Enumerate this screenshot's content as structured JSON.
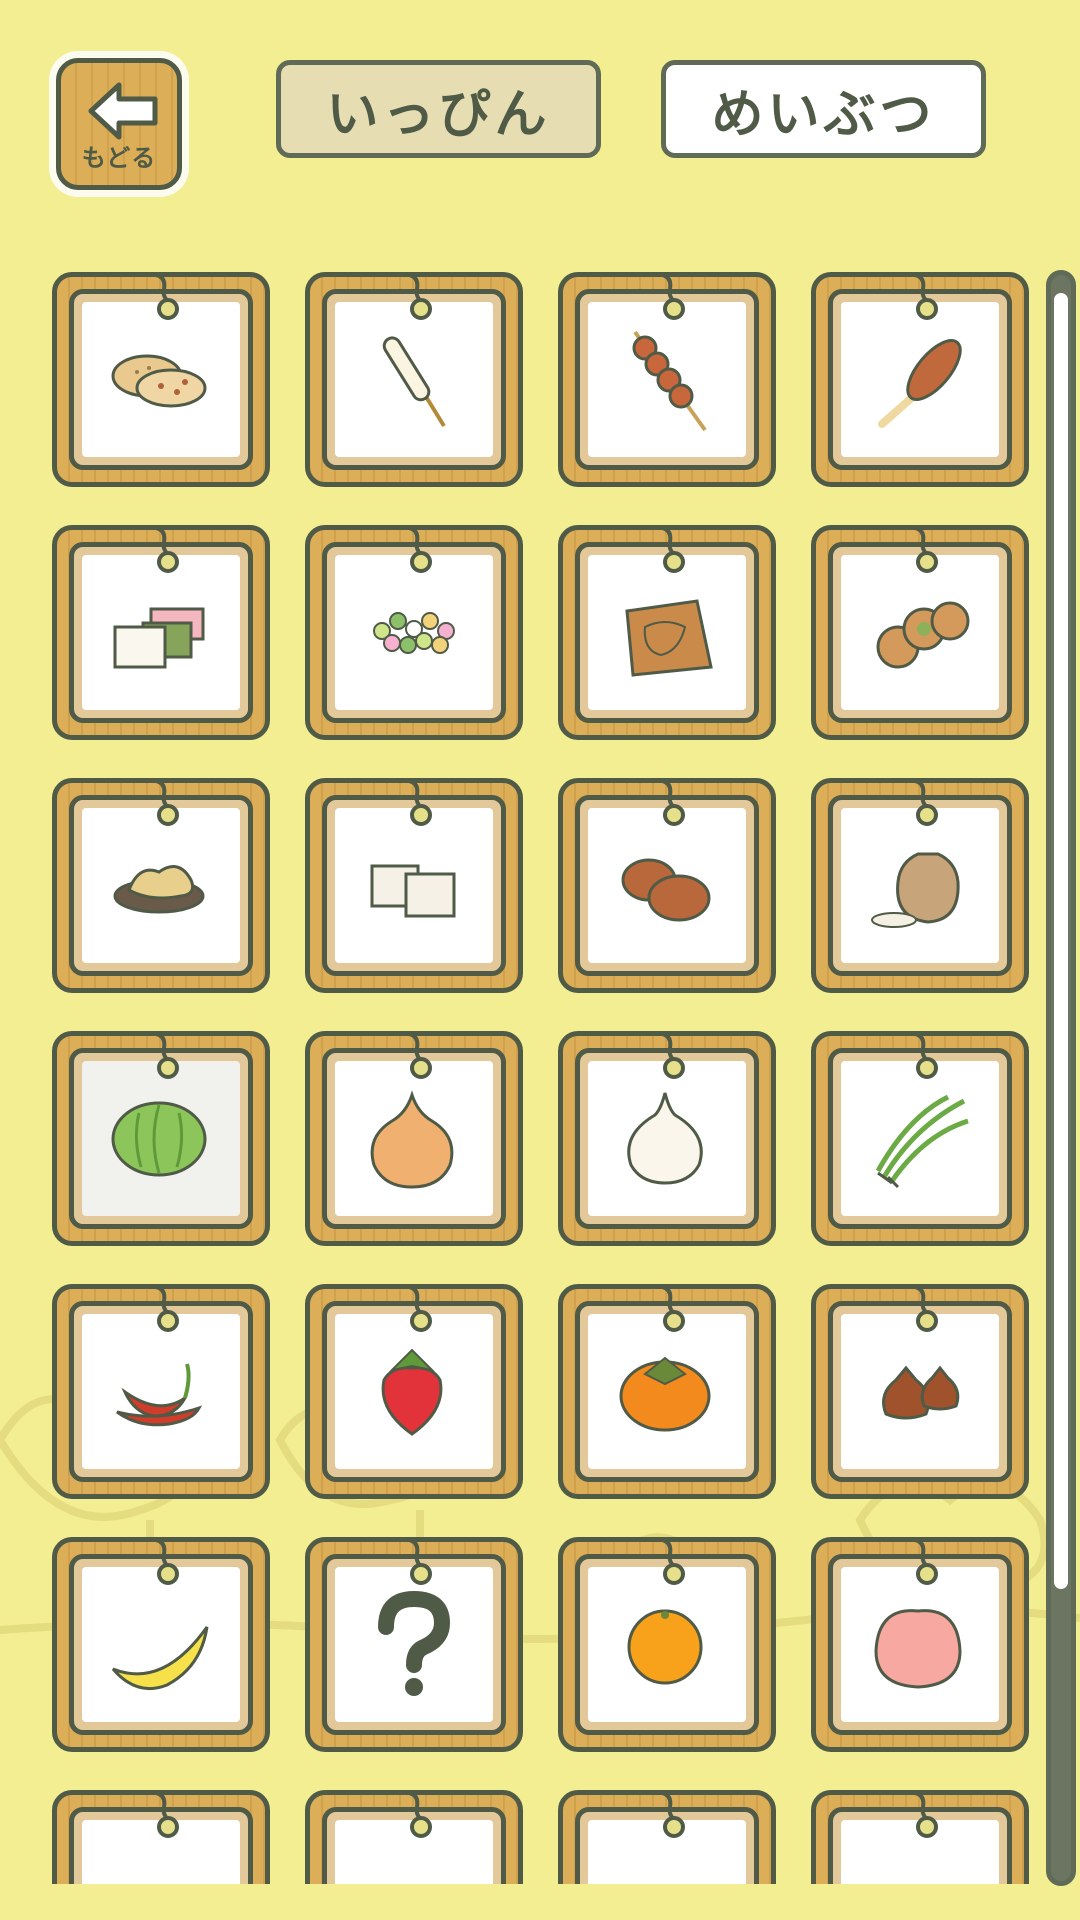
{
  "header": {
    "back_label": "もどる",
    "tabs": [
      {
        "label": "いっぴん",
        "selected": true
      },
      {
        "label": "めいぶつ",
        "selected": false
      }
    ]
  },
  "colors": {
    "background": "#f3ee92",
    "wood": "#dcae57",
    "outline": "#4f5a47",
    "tab_selected": "#e6deb2"
  },
  "grid": {
    "columns": 4,
    "items": [
      {
        "icon": "rice-cracker-icon"
      },
      {
        "icon": "goheimochi-stick-icon"
      },
      {
        "icon": "dango-skewer-icon"
      },
      {
        "icon": "grilled-mochi-stick-icon"
      },
      {
        "icon": "layered-mochi-icon"
      },
      {
        "icon": "colored-candy-balls-icon"
      },
      {
        "icon": "wrapped-senbei-icon"
      },
      {
        "icon": "manju-pastries-icon"
      },
      {
        "icon": "fried-snack-plate-icon"
      },
      {
        "icon": "tofu-blocks-icon"
      },
      {
        "icon": "steamed-buns-icon"
      },
      {
        "icon": "rice-bag-icon"
      },
      {
        "icon": "cabbage-icon",
        "dim": true
      },
      {
        "icon": "onion-icon"
      },
      {
        "icon": "garlic-icon"
      },
      {
        "icon": "green-onion-icon"
      },
      {
        "icon": "chili-pepper-icon"
      },
      {
        "icon": "strawberry-icon"
      },
      {
        "icon": "persimmon-icon"
      },
      {
        "icon": "chestnut-icon"
      },
      {
        "icon": "banana-icon"
      },
      {
        "icon": "question-mark-icon"
      },
      {
        "icon": "mandarin-orange-icon"
      },
      {
        "icon": "peach-icon"
      },
      {
        "icon": "apple-icon"
      },
      {
        "icon": "milk-jug-icon"
      },
      {
        "icon": "cheese-icon"
      },
      {
        "icon": "canned-food-icon"
      }
    ]
  }
}
